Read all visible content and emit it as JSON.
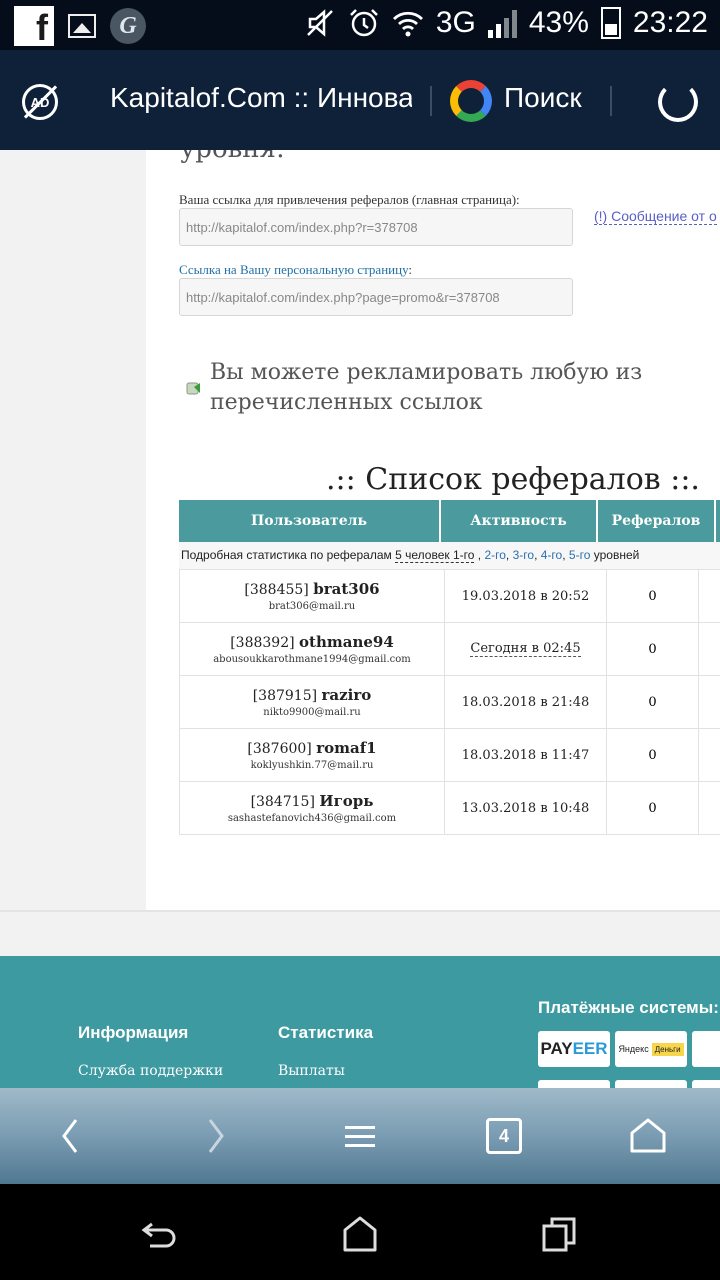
{
  "status_bar": {
    "facebook_icon": "f",
    "g_icon": "G",
    "network": "3G",
    "battery": "43%",
    "time": "23:22"
  },
  "browser": {
    "title": "Kapitalof.Com :: Инновационный",
    "search_label": "Поиск",
    "adblock_label": "AD",
    "tabs_count": "4"
  },
  "page": {
    "cut_heading": "уровня:",
    "ref_link_label": "Ваша ссылка для привлечения рефералов (главная страница):",
    "ref_link_value": "http://kapitalof.com/index.php?r=378708",
    "message_link": "(!) Сообщение от о",
    "personal_link_label": "Ссылка на Вашу персональную страницу",
    "personal_link_colon": ":",
    "personal_link_value": "http://kapitalof.com/index.php?page=promo&r=378708",
    "promo_text": "Вы можете рекламировать любую из перечисленных ссылок",
    "list_title": ".:: Список рефералов ::.",
    "table": {
      "headers": [
        "Пользователь",
        "Активность",
        "Рефералов"
      ],
      "stats_prefix": "Подробная статистика по рефералам",
      "stats_count": "5 человек 1-го",
      "stats_sep": ",",
      "stats_levels": [
        "2-го",
        "3-го",
        "4-го",
        "5-го"
      ],
      "stats_suffix": "уровней",
      "rows": [
        {
          "id": "[388455]",
          "login": "brat306",
          "email": "brat306@mail.ru",
          "activity": "19.03.2018 в 20:52",
          "referrals": "0"
        },
        {
          "id": "[388392]",
          "login": "othmane94",
          "email": "abousoukkarothmane1994@gmail.com",
          "activity": "Сегодня в 02:45",
          "referrals": "0"
        },
        {
          "id": "[387915]",
          "login": "raziro",
          "email": "nikto9900@mail.ru",
          "activity": "18.03.2018 в 21:48",
          "referrals": "0"
        },
        {
          "id": "[387600]",
          "login": "romaf1",
          "email": "koklyushkin.77@mail.ru",
          "activity": "18.03.2018 в 11:47",
          "referrals": "0"
        },
        {
          "id": "[384715]",
          "login": "Игорь",
          "email": "sashastefanovich436@gmail.com",
          "activity": "13.03.2018 в 10:48",
          "referrals": "0"
        }
      ]
    }
  },
  "footer": {
    "payment_title": "Платёжные системы:",
    "info_title": "Информация",
    "stats_title": "Статистика",
    "support_link": "Служба поддержки",
    "payouts_link": "Выплаты",
    "payeer_a": "PAY",
    "payeer_b": "EER",
    "yandex_a": "Яндекс",
    "yandex_b": "Деньги"
  },
  "colors": {
    "table_header": "#4a9a9e",
    "footer": "#3d9aa0",
    "toolbar": "#0e2138",
    "link": "#2b6fb0"
  }
}
